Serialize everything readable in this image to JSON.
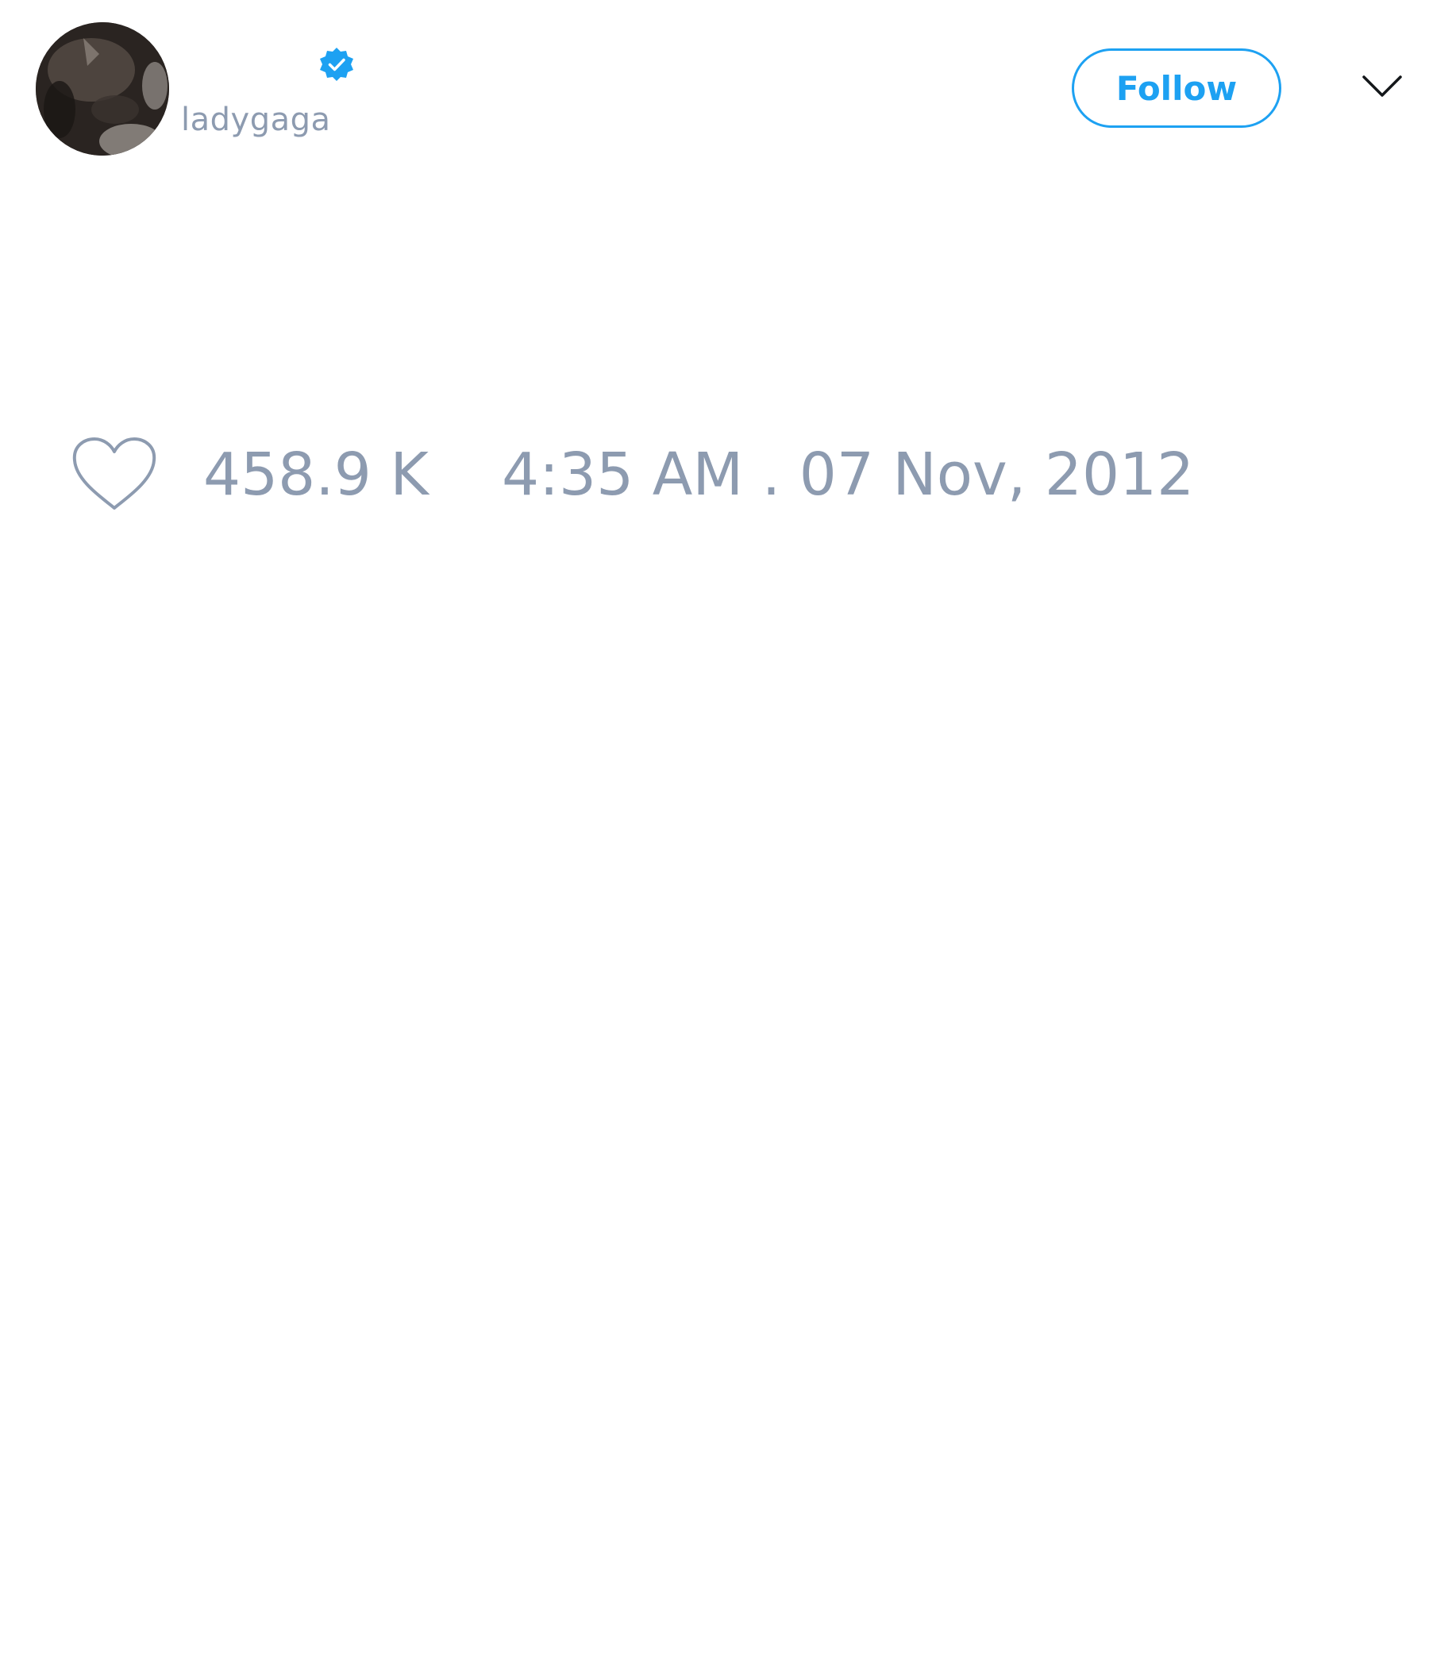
{
  "tweet": {
    "author": {
      "display_name": "",
      "handle": "ladygaga",
      "verified": true,
      "avatar_icon": "avatar-photo"
    },
    "follow_label": "Follow",
    "menu_icon": "chevron-down-icon",
    "like_icon": "heart-outline-icon",
    "like_count": "458.9 K",
    "timestamp": "4:35 AM . 07 Nov, 2012"
  },
  "colors": {
    "accent": "#1da1f2",
    "muted_text": "#8d9bb0",
    "background": "#ffffff",
    "verified_badge": "#1da1f2"
  }
}
